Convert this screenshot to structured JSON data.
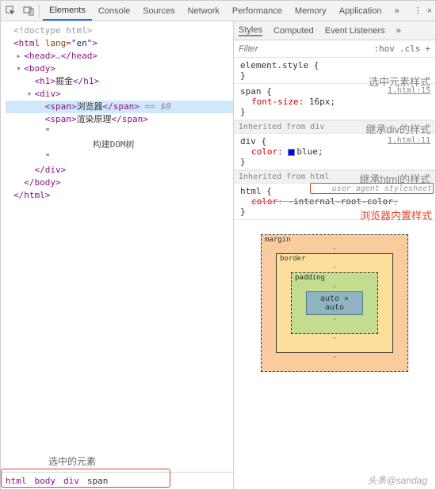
{
  "topbar": {
    "tabs": [
      "Elements",
      "Console",
      "Sources",
      "Network",
      "Performance",
      "Memory",
      "Application"
    ],
    "active": 0,
    "more": "»",
    "menu": "⋮",
    "close": "×"
  },
  "dom": {
    "lines": [
      {
        "indent": 0,
        "arrow": "",
        "html": "<!doctype html>",
        "cls": "t-doctype"
      },
      {
        "indent": 0,
        "arrow": "",
        "html": "<html lang=\"en\">",
        "tag": true,
        "attr": true
      },
      {
        "indent": 1,
        "arrow": "▸",
        "html": "<head>…</head>",
        "tag": true,
        "expand": true
      },
      {
        "indent": 1,
        "arrow": "▾",
        "html": "<body>",
        "tag": true
      },
      {
        "indent": 2,
        "arrow": "",
        "html": "<h1>掘金</h1>",
        "tag": true,
        "mixed": true
      },
      {
        "indent": 2,
        "arrow": "▾",
        "html": "<div>",
        "tag": true
      },
      {
        "indent": 3,
        "arrow": "",
        "html": "<span>浏览器</span> == $0",
        "tag": true,
        "mixed": true,
        "selected": true,
        "eq0": true
      },
      {
        "indent": 3,
        "arrow": "",
        "html": "<span>渲染原理</span>",
        "tag": true,
        "mixed": true
      },
      {
        "indent": 3,
        "arrow": "",
        "html": "\"",
        "plain": true
      },
      {
        "indent": 3,
        "arrow": "",
        "html": "构建DOM树",
        "plain": true,
        "center": true
      },
      {
        "indent": 3,
        "arrow": "",
        "html": "\"",
        "plain": true
      },
      {
        "indent": 2,
        "arrow": "",
        "html": "</div>",
        "tag": true
      },
      {
        "indent": 1,
        "arrow": "",
        "html": "</body>",
        "tag": true
      },
      {
        "indent": 0,
        "arrow": "",
        "html": "</html>",
        "tag": true
      }
    ]
  },
  "crumb": {
    "items": [
      "html",
      "body",
      "div",
      "span"
    ],
    "annot": "选中的元素"
  },
  "styles": {
    "tabs": [
      "Styles",
      "Computed",
      "Event Listeners"
    ],
    "more": "»",
    "filter_ph": "Filter",
    "opts": [
      ":hov",
      ".cls",
      "+"
    ],
    "annot_sel": "选中元素样式",
    "annot_div": "继承div的样式",
    "annot_html": "继承html的样式",
    "annot_ua": "浏览器内置样式",
    "rules": {
      "elstyle_sel": "element.style",
      "span_sel": "span",
      "span_link": "1.html:15",
      "span_prop": "font-size",
      "span_val": "16px",
      "inh_div_label": "Inherited from div",
      "div_sel": "div",
      "div_link": "1.html:11",
      "div_prop": "color",
      "div_val": "blue",
      "div_swatch": "#0000ff",
      "inh_html_label": "Inherited from html",
      "html_sel": "html",
      "ua_label": "user agent stylesheet",
      "html_prop": "color",
      "html_val": "-internal-root-color"
    }
  },
  "boxmodel": {
    "margin": "margin",
    "border": "border",
    "padding": "padding",
    "content": "auto × auto",
    "dash": "-"
  },
  "watermark": "头条@sandag"
}
